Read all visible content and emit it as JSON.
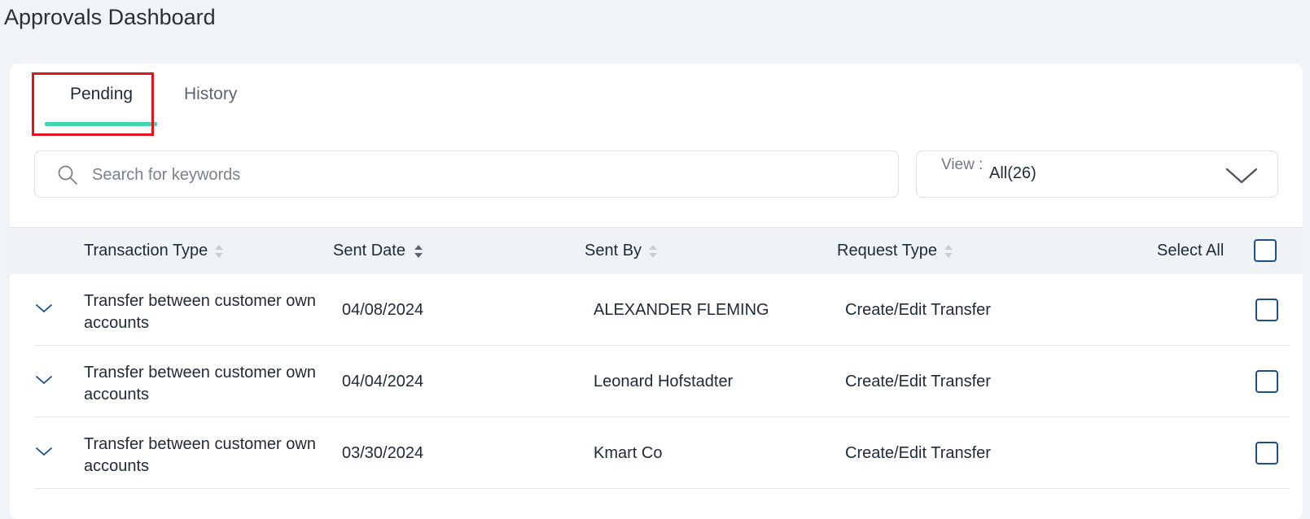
{
  "header": {
    "title": "Approvals Dashboard"
  },
  "tabs": [
    {
      "label": "Pending",
      "active": true
    },
    {
      "label": "History",
      "active": false
    }
  ],
  "search": {
    "placeholder": "Search for keywords",
    "value": ""
  },
  "view_filter": {
    "label": "View :",
    "value": "All(26)"
  },
  "table": {
    "columns": {
      "transaction_type": "Transaction Type",
      "sent_date": "Sent Date",
      "sent_by": "Sent By",
      "request_type": "Request Type",
      "select_all": "Select All"
    },
    "rows": [
      {
        "transaction_type": "Transfer between customer own accounts",
        "sent_date": "04/08/2024",
        "sent_by": "ALEXANDER FLEMING",
        "request_type": "Create/Edit Transfer"
      },
      {
        "transaction_type": "Transfer between customer own accounts",
        "sent_date": "04/04/2024",
        "sent_by": "Leonard Hofstadter",
        "request_type": "Create/Edit Transfer"
      },
      {
        "transaction_type": "Transfer between customer own accounts",
        "sent_date": "03/30/2024",
        "sent_by": "Kmart Co",
        "request_type": "Create/Edit Transfer"
      }
    ]
  },
  "colors": {
    "accent": "#3fd6ad",
    "highlight": "#e2131c",
    "checkbox_border": "#1e4f86",
    "page_bg": "#f1f4f7"
  },
  "icons": {
    "search": "search-icon",
    "view_dropdown": "chevron-down-icon",
    "sort": "sort-icon",
    "row_expand": "chevron-down-icon"
  }
}
